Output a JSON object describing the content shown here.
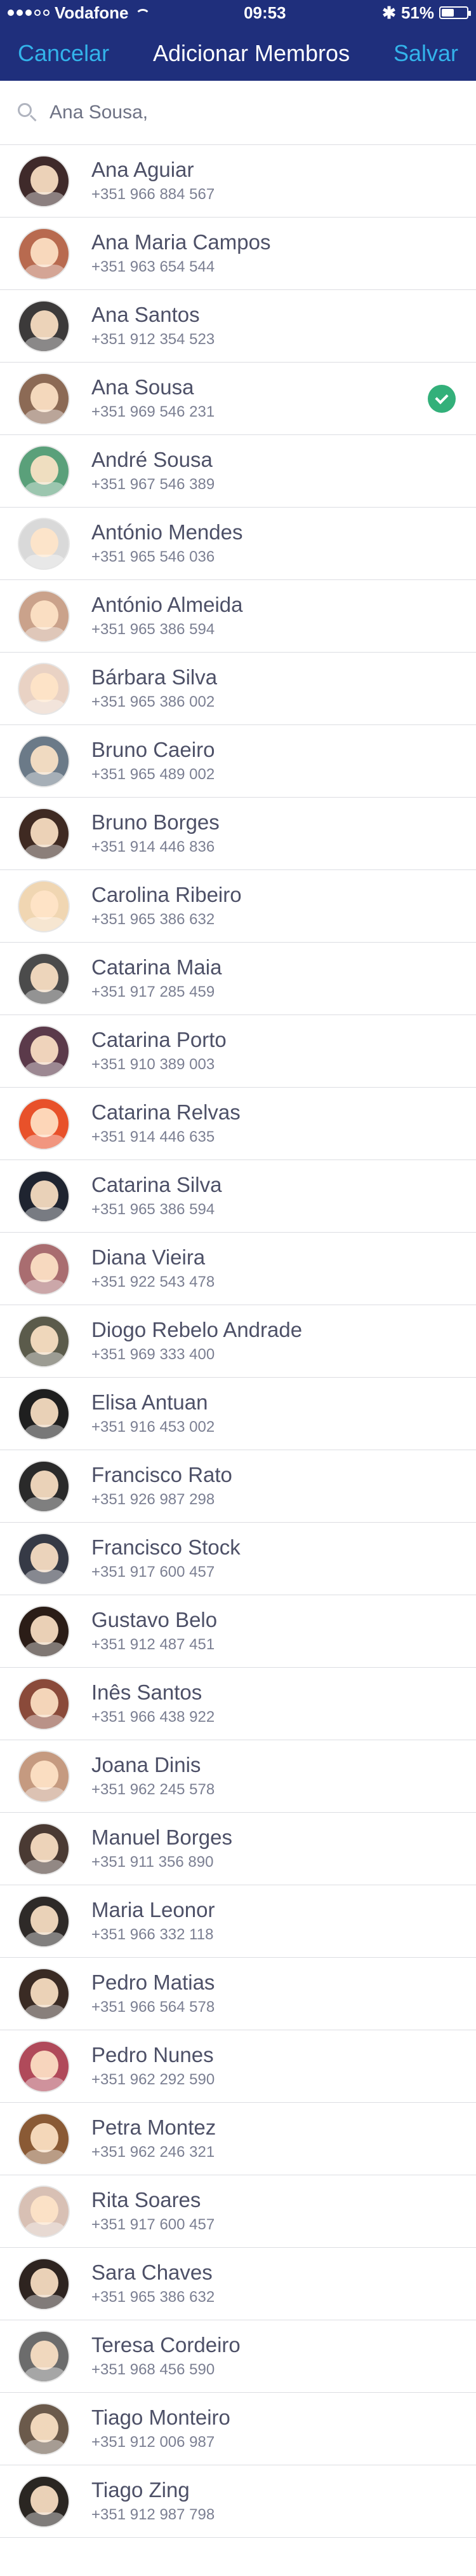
{
  "status": {
    "carrier": "Vodafone",
    "time": "09:53",
    "battery": "51%",
    "battery_level": 0.51
  },
  "nav": {
    "cancel": "Cancelar",
    "title": "Adicionar Membros",
    "save": "Salvar"
  },
  "search": {
    "value": "Ana Sousa,"
  },
  "contacts": [
    {
      "name": "Ana Aguiar",
      "phone": "+351 966 884 567",
      "color": "#3f2a2a"
    },
    {
      "name": "Ana Maria Campos",
      "phone": "+351 963 654 544",
      "color": "#b86a4f"
    },
    {
      "name": "Ana Santos",
      "phone": "+351 912 354 523",
      "color": "#3c3a3a"
    },
    {
      "name": "Ana Sousa",
      "phone": "+351 969 546 231",
      "color": "#8c6a55",
      "selected": true
    },
    {
      "name": "André Sousa",
      "phone": "+351 967 546 389",
      "color": "#5aa07a"
    },
    {
      "name": "António Mendes",
      "phone": "+351 965 546 036",
      "color": "#d9d9d9"
    },
    {
      "name": "António Almeida",
      "phone": "+351 965 386 594",
      "color": "#caa28b"
    },
    {
      "name": "Bárbara Silva",
      "phone": "+351 965 386 002",
      "color": "#e9d2c4"
    },
    {
      "name": "Bruno Caeiro",
      "phone": "+351 965 489 002",
      "color": "#6b7a88"
    },
    {
      "name": "Bruno Borges",
      "phone": "+351 914 446 836",
      "color": "#3f2a22"
    },
    {
      "name": "Carolina Ribeiro",
      "phone": "+351 965 386 632",
      "color": "#f0d6b2"
    },
    {
      "name": "Catarina Maia",
      "phone": "+351 917 285 459",
      "color": "#4b4b4b"
    },
    {
      "name": "Catarina Porto",
      "phone": "+351 910 389 003",
      "color": "#5b3a4a"
    },
    {
      "name": "Catarina Relvas",
      "phone": "+351 914 446 635",
      "color": "#e8512a"
    },
    {
      "name": "Catarina Silva",
      "phone": "+351 965 386 594",
      "color": "#1f2430"
    },
    {
      "name": "Diana Vieira",
      "phone": "+351 922 543 478",
      "color": "#a96d70"
    },
    {
      "name": "Diogo Rebelo Andrade",
      "phone": "+351 969 333 400",
      "color": "#5b5b4b"
    },
    {
      "name": "Elisa Antuan",
      "phone": "+351 916 453 002",
      "color": "#1f1f1f"
    },
    {
      "name": "Francisco Rato",
      "phone": "+351 926 987 298",
      "color": "#2a2a2a"
    },
    {
      "name": "Francisco Stock",
      "phone": "+351 917 600 457",
      "color": "#363a46"
    },
    {
      "name": "Gustavo Belo",
      "phone": "+351 912 487 451",
      "color": "#2b1d17"
    },
    {
      "name": "Inês Santos",
      "phone": "+351 966 438 922",
      "color": "#8a4a3a"
    },
    {
      "name": "Joana Dinis",
      "phone": "+351 962 245 578",
      "color": "#c59a80"
    },
    {
      "name": "Manuel Borges",
      "phone": "+351 911 356 890",
      "color": "#4a3a33"
    },
    {
      "name": "Maria Leonor",
      "phone": "+351 966 332 118",
      "color": "#2e2a28"
    },
    {
      "name": "Pedro Matias",
      "phone": "+351 966 564 578",
      "color": "#3a2b24"
    },
    {
      "name": "Pedro Nunes",
      "phone": "+351 962 292 590",
      "color": "#b04a5a"
    },
    {
      "name": "Petra Montez",
      "phone": "+351 962 246 321",
      "color": "#8a5a35"
    },
    {
      "name": "Rita Soares",
      "phone": "+351 917 600 457",
      "color": "#d8c0b4"
    },
    {
      "name": "Sara Chaves",
      "phone": "+351 965 386 632",
      "color": "#2e2420"
    },
    {
      "name": "Teresa Cordeiro",
      "phone": "+351 968 456 590",
      "color": "#6c6c6c"
    },
    {
      "name": "Tiago Monteiro",
      "phone": "+351 912 006 987",
      "color": "#6b5a4b"
    },
    {
      "name": "Tiago Zing",
      "phone": "+351 912 987 798",
      "color": "#2a2622"
    }
  ]
}
